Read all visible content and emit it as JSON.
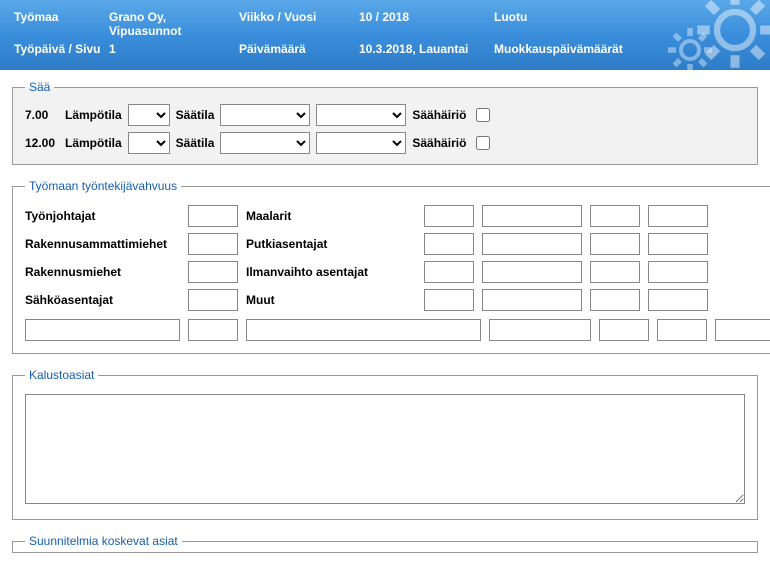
{
  "header": {
    "r1": {
      "c1": "Työmaa",
      "c2": "Grano Oy, Vipuasunnot",
      "c3": "Viikko / Vuosi",
      "c4": "10 / 2018",
      "c5": "Luotu"
    },
    "r2": {
      "c1": "Työpäivä / Sivu",
      "c2": "1",
      "c3": "Päivämäärä",
      "c4": "10.3.2018, Lauantai",
      "c5": "Muokkauspäivämäärät"
    }
  },
  "saa": {
    "legend": "Sää",
    "rows": [
      {
        "time": "7.00",
        "tempLabel": "Lämpötila",
        "weatherLabel": "Säätila",
        "disturbLabel": "Säähäiriö"
      },
      {
        "time": "12.00",
        "tempLabel": "Lämpötila",
        "weatherLabel": "Säätila",
        "disturbLabel": "Säähäiriö"
      }
    ]
  },
  "tyontekija": {
    "legend": "Työmaan työntekijävahvuus",
    "labels": {
      "tyonjohtajat": "Työnjohtajat",
      "maalarit": "Maalarit",
      "rakennusammattimiehet": "Rakennusammattimiehet",
      "putkiasentajat": "Putkiasentajat",
      "rakennusmiehet": "Rakennusmiehet",
      "ilmanvaihto": "Ilmanvaihto asentajat",
      "sahkoasentajat": "Sähköasentajat",
      "muut": "Muut"
    }
  },
  "kalusto": {
    "legend": "Kalustoasiat"
  },
  "suunnitelma": {
    "legend": "Suunnitelmia koskevat asiat"
  }
}
